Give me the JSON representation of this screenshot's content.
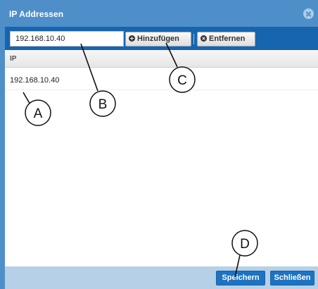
{
  "window": {
    "title": "IP Addressen",
    "close_icon": "close-circle-icon"
  },
  "toolbar": {
    "ip_input_value": "192.168.10.40",
    "add_label": "Hinzufügen",
    "add_icon": "plus-circle-icon",
    "remove_label": "Entfernen",
    "remove_icon": "x-circle-icon"
  },
  "grid": {
    "columns": [
      "IP"
    ],
    "rows": [
      {
        "ip": "192.168.10.40"
      }
    ]
  },
  "footer": {
    "save_label": "Speichern",
    "close_label": "Schließen"
  },
  "callouts": [
    "A",
    "B",
    "C",
    "D"
  ],
  "colors": {
    "titlebar": "#4f8fc9",
    "toolbar": "#1764af",
    "footer": "#b6d0e7",
    "button": "#1d73c2"
  }
}
